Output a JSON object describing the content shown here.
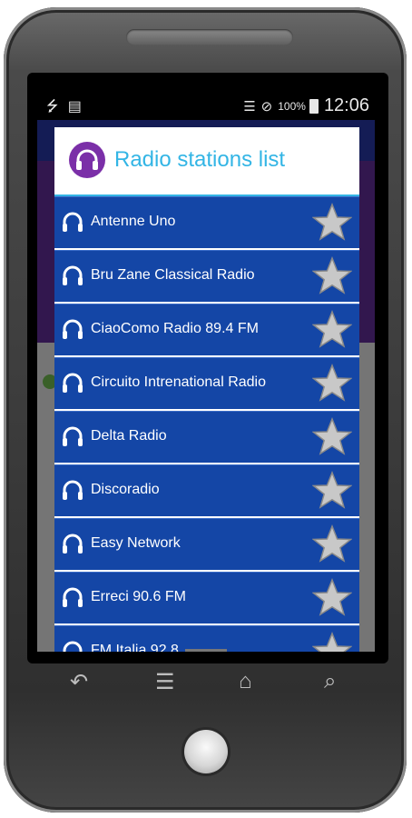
{
  "status_bar": {
    "time": "12:06",
    "battery": "100%"
  },
  "dialog": {
    "title": "Radio stations list",
    "stations": [
      {
        "name": "Antenne Uno"
      },
      {
        "name": "Bru Zane Classical Radio"
      },
      {
        "name": "CiaoComo Radio 89.4 FM"
      },
      {
        "name": "Circuito Intrenational Radio"
      },
      {
        "name": "Delta Radio"
      },
      {
        "name": "Discoradio"
      },
      {
        "name": "Easy Network"
      },
      {
        "name": "Erreci 90.6 FM"
      },
      {
        "name": "FM Italia 92.8"
      }
    ]
  },
  "colors": {
    "title": "#33b5e5",
    "row_bg": "#1446a6",
    "app_icon": "#7b2fa8",
    "star": "#c8c8c8"
  },
  "icons": {
    "usb": "usb-icon",
    "sdcard": "sdcard-icon",
    "wifi": "wifi-icon",
    "no_signal": "no-signal-icon",
    "battery": "battery-icon",
    "back": "back-icon",
    "menu": "menu-icon",
    "home": "home-icon",
    "search": "search-icon",
    "headphones": "headphones-icon",
    "star": "star-icon"
  }
}
